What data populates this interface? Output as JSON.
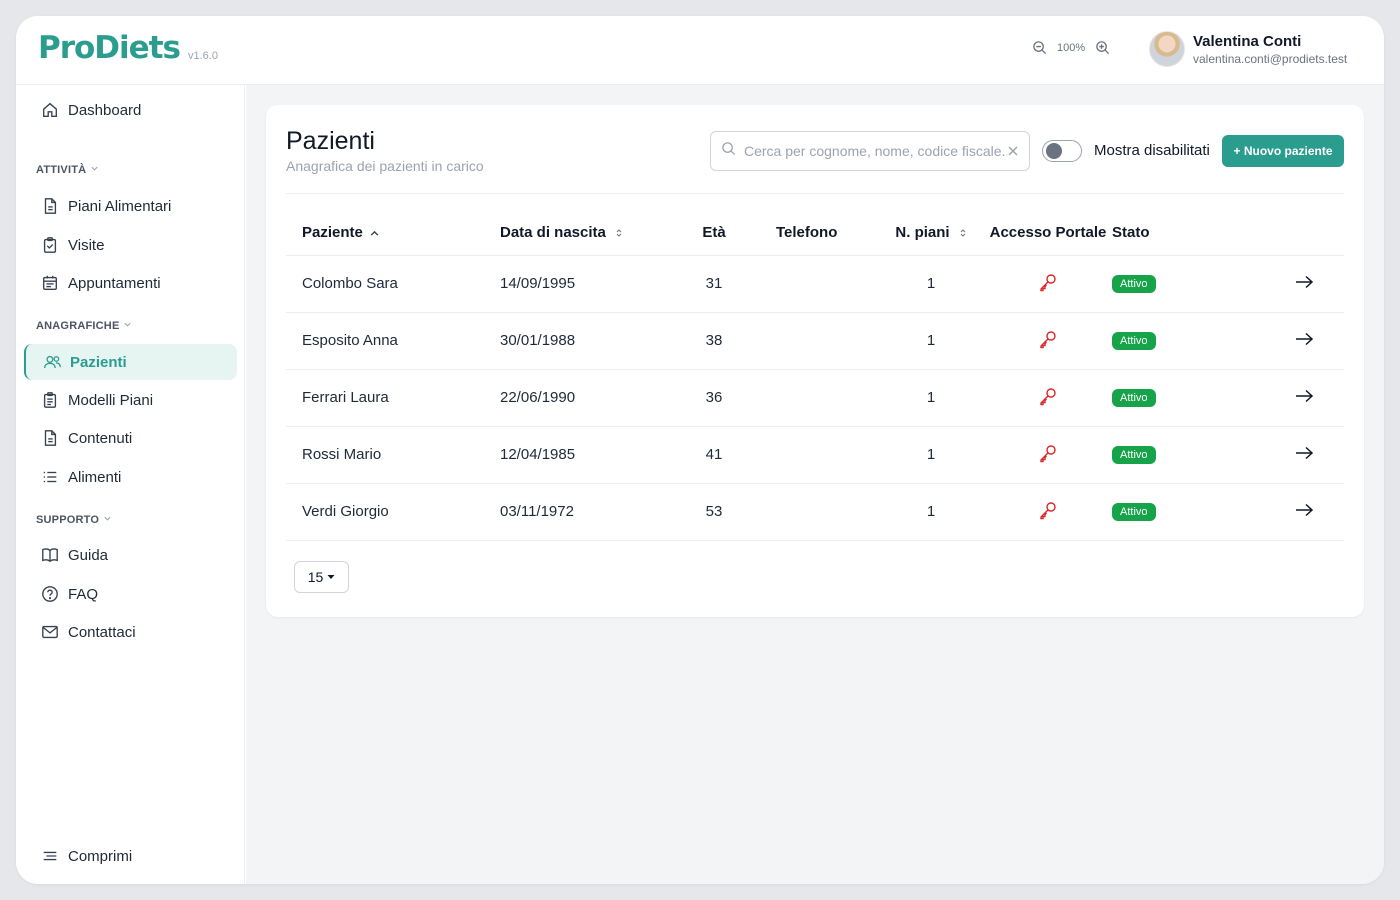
{
  "app": {
    "name": "ProDiets",
    "version": "v1.6.0"
  },
  "zoom": {
    "level": "100%"
  },
  "user": {
    "name": "Valentina Conti",
    "email": "valentina.conti@prodiets.test"
  },
  "sidebar": {
    "dashboard": "Dashboard",
    "sections": [
      {
        "label": "ATTIVITÀ",
        "items": [
          "Piani Alimentari",
          "Visite",
          "Appuntamenti"
        ]
      },
      {
        "label": "ANAGRAFICHE",
        "items": [
          "Pazienti",
          "Modelli Piani",
          "Contenuti",
          "Alimenti"
        ]
      },
      {
        "label": "SUPPORTO",
        "items": [
          "Guida",
          "FAQ",
          "Contattaci"
        ]
      }
    ],
    "active": "Pazienti",
    "collapse": "Comprimi"
  },
  "page": {
    "title": "Pazienti",
    "subtitle": "Anagrafica dei pazienti in carico",
    "search_placeholder": "Cerca per cognome, nome, codice fiscale...",
    "toggle_label": "Mostra disabilitati",
    "new_button": "+ Nuovo paziente"
  },
  "table": {
    "headers": [
      "Paziente",
      "Data di nascita",
      "Età",
      "Telefono",
      "N. piani",
      "Accesso Portale",
      "Stato"
    ],
    "rows": [
      {
        "name": "Colombo Sara",
        "dob": "14/09/1995",
        "age": "31",
        "phone": "",
        "plans": "1",
        "status": "Attivo"
      },
      {
        "name": "Esposito Anna",
        "dob": "30/01/1988",
        "age": "38",
        "phone": "",
        "plans": "1",
        "status": "Attivo"
      },
      {
        "name": "Ferrari Laura",
        "dob": "22/06/1990",
        "age": "36",
        "phone": "",
        "plans": "1",
        "status": "Attivo"
      },
      {
        "name": "Rossi Mario",
        "dob": "12/04/1985",
        "age": "41",
        "phone": "",
        "plans": "1",
        "status": "Attivo"
      },
      {
        "name": "Verdi Giorgio",
        "dob": "03/11/1972",
        "age": "53",
        "phone": "",
        "plans": "1",
        "status": "Attivo"
      }
    ]
  },
  "pager": {
    "page_size": "15"
  },
  "colors": {
    "brand": "#2a9d8f",
    "status_active": "#16a34a",
    "key_icon": "#dc2626"
  }
}
